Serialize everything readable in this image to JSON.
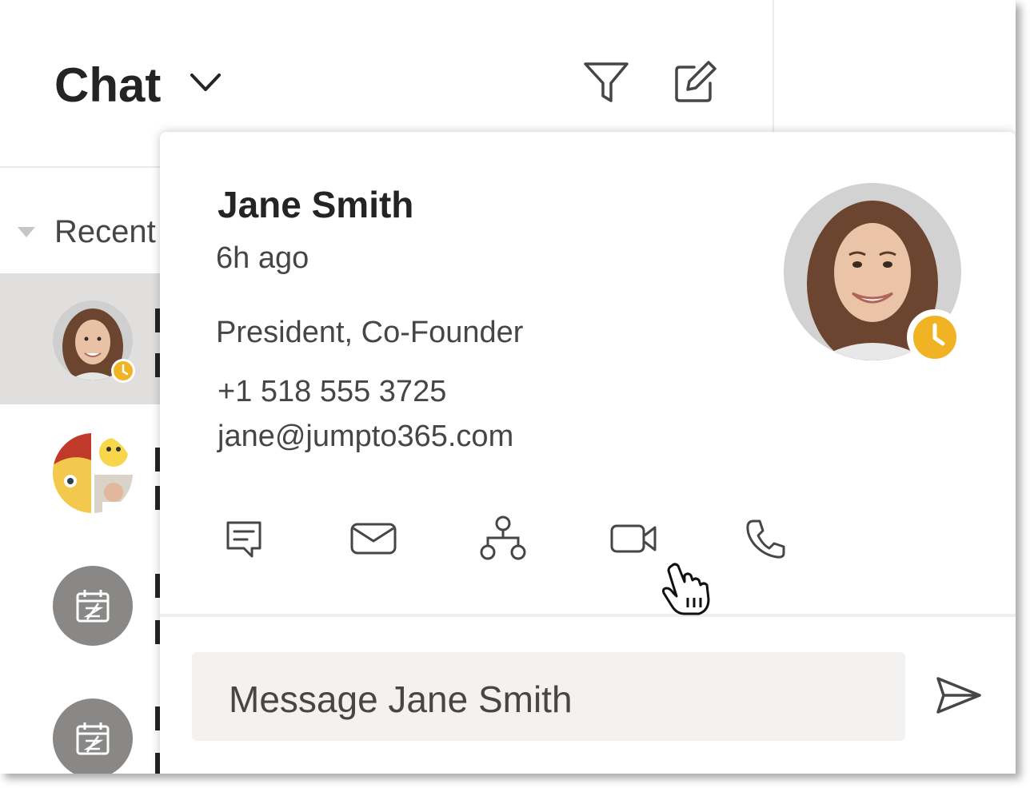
{
  "header": {
    "title": "Chat",
    "chevron_icon": "chevron-down-icon",
    "filter_icon": "filter-icon",
    "compose_icon": "compose-icon"
  },
  "sidebar": {
    "section_label": "Recent"
  },
  "contact_card": {
    "name": "Jane Smith",
    "status_time": "6h ago",
    "title": "President, Co-Founder",
    "phone": "+1 518 555 3725",
    "email": "jane@jumpto365.com",
    "presence": "away",
    "actions": [
      {
        "name": "chat",
        "icon": "chat-icon"
      },
      {
        "name": "email",
        "icon": "mail-icon"
      },
      {
        "name": "org-chart",
        "icon": "org-chart-icon"
      },
      {
        "name": "video-call",
        "icon": "video-icon"
      },
      {
        "name": "audio-call",
        "icon": "phone-icon"
      }
    ],
    "message_placeholder": "Message Jane Smith",
    "send_icon": "send-icon"
  },
  "colors": {
    "presence_away": "#f0b324",
    "selected_row": "#e1dfdd",
    "meeting_avatar": "#8a8886",
    "input_bg": "#f3f2f1"
  }
}
